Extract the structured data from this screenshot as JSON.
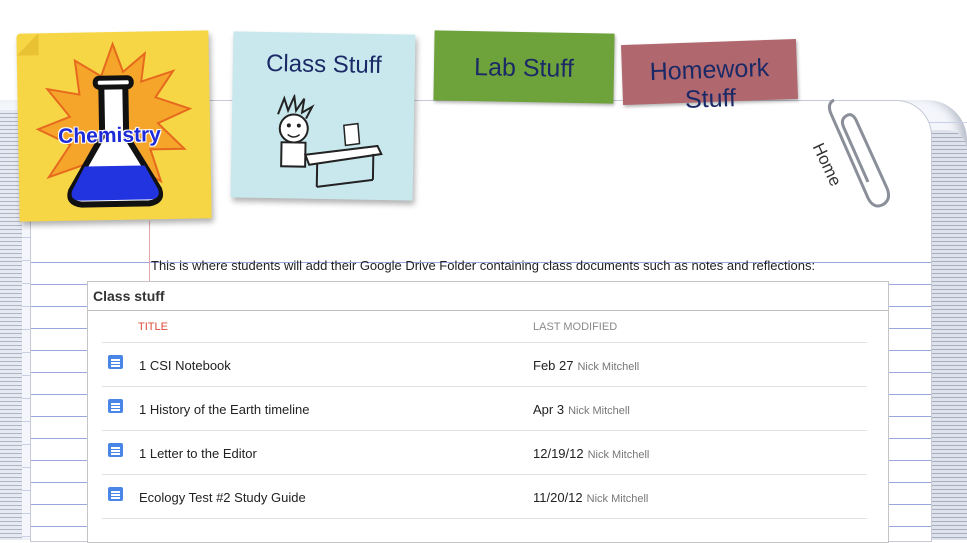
{
  "header": {
    "logo_text": "Chemistry",
    "tabs": [
      {
        "label": "Class Stuff"
      },
      {
        "label": "Lab Stuff"
      },
      {
        "label": "Homework Stuff"
      }
    ],
    "home_label": "Home"
  },
  "intro_text": "This is where students will add their Google Drive Folder containing class documents such as notes and reflections:",
  "folder": {
    "title": "Class stuff",
    "columns": {
      "title": "TITLE",
      "modified": "LAST MODIFIED"
    },
    "rows": [
      {
        "name": "1 CSI Notebook",
        "date": "Feb 27",
        "author": "Nick Mitchell"
      },
      {
        "name": "1 History of the Earth timeline",
        "date": "Apr 3",
        "author": "Nick Mitchell"
      },
      {
        "name": "1 Letter to the Editor",
        "date": "12/19/12",
        "author": "Nick Mitchell"
      },
      {
        "name": "Ecology Test #2 Study Guide",
        "date": "11/20/12",
        "author": "Nick Mitchell"
      }
    ]
  },
  "colors": {
    "sticky_yellow": "#f7d646",
    "class_tab": "#c9e8ee",
    "lab_tab": "#6ea23a",
    "homework_tab": "#b1676e",
    "doc_icon": "#4a86e8",
    "title_column": "#dd4b39"
  }
}
